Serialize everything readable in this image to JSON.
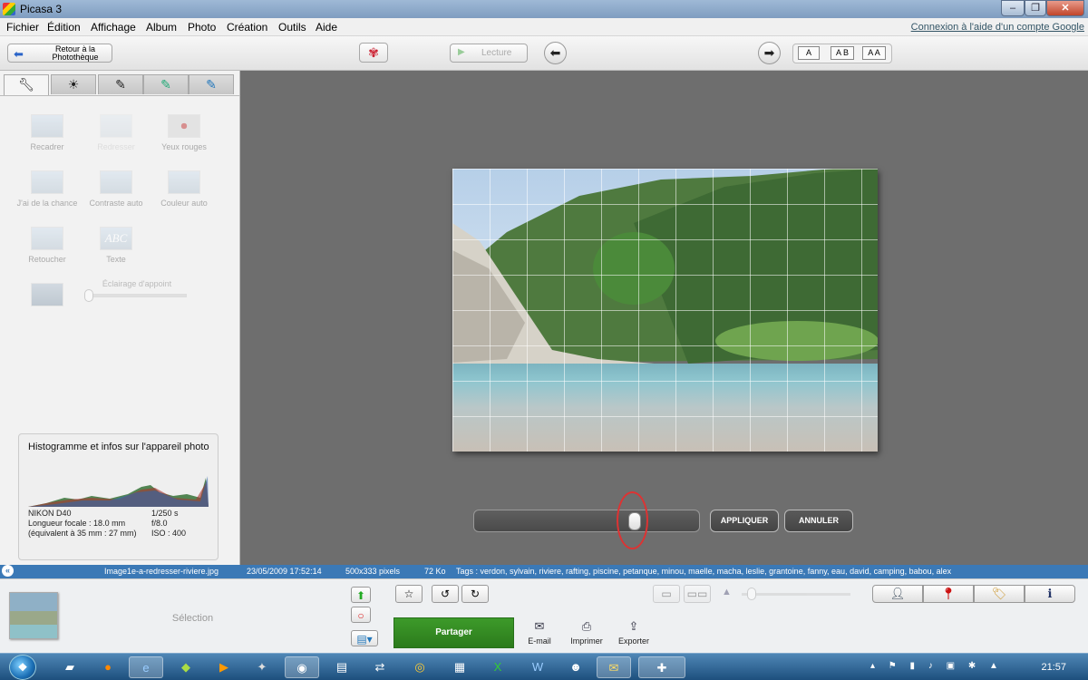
{
  "window": {
    "title": "Picasa 3",
    "min": "–",
    "max": "❐",
    "close": "✕"
  },
  "menu": {
    "items": [
      "Fichier",
      "Édition",
      "Affichage",
      "Album",
      "Photo",
      "Création",
      "Outils",
      "Aide"
    ],
    "google_link": "Connexion à l'aide d'un compte Google"
  },
  "toolbar": {
    "back_line1": "Retour à la",
    "back_line2": "Photothèque",
    "play_label": "Lecture",
    "caption_a": "A",
    "caption_ab": "A B",
    "caption_aa": "A A"
  },
  "edit_panel": {
    "tabs": [
      "wrench-icon",
      "sun-icon",
      "brush-icon",
      "green-effect-icon",
      "blue-effect-icon"
    ],
    "tools": [
      {
        "label": "Recadrer"
      },
      {
        "label": "Redresser"
      },
      {
        "label": "Yeux rouges"
      },
      {
        "label": "J'ai de la chance"
      },
      {
        "label": "Contraste auto"
      },
      {
        "label": "Couleur auto"
      },
      {
        "label": "Retoucher"
      },
      {
        "label": "Texte"
      }
    ],
    "text_icon_label": "ABC",
    "fill_light_label": "Éclairage d'appoint",
    "fill_light_level": 0
  },
  "histogram": {
    "title": "Histogramme et infos sur l'appareil photo",
    "camera": "NIKON D40",
    "focal": "Longueur focale : 18.0 mm",
    "equiv": "(équivalent à 35 mm : 27 mm)",
    "shutter": "1/250 s",
    "aperture": "f/8.0",
    "iso": "ISO : 400"
  },
  "straighten": {
    "apply_label": "APPLIQUER",
    "cancel_label": "ANNULER",
    "slider_value": 0.7
  },
  "status": {
    "filename": "Image1e-a-redresser-riviere.jpg",
    "date": "23/05/2009 17:52:14",
    "dimensions": "500x333 pixels",
    "size": "72 Ko",
    "tags": "Tags : verdon, sylvain, riviere, rafting, piscine, petanque, minou, maelle, macha, leslie, grantoine, fanny, eau, david, camping, babou, alex"
  },
  "tray": {
    "selection_label": "Sélection",
    "share_label": "Partager",
    "email_label": "E-mail",
    "print_label": "Imprimer",
    "export_label": "Exporter"
  },
  "taskbar": {
    "clock": "21:57"
  }
}
